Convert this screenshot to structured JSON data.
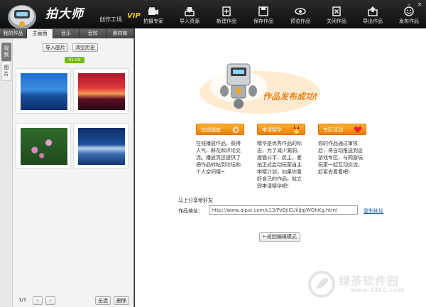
{
  "app": {
    "brand": "拍大师",
    "brand_sub": "创作工场",
    "brand_vip": "VIP"
  },
  "toolbar": [
    {
      "name": "拍摄专家",
      "icon": "camera-icon"
    },
    {
      "name": "导入资源",
      "icon": "import-icon"
    },
    {
      "name": "新建作品",
      "icon": "new-file-icon"
    },
    {
      "name": "保存作品",
      "icon": "save-icon"
    },
    {
      "name": "预览作品",
      "icon": "preview-eye-icon"
    },
    {
      "name": "关闭作品",
      "icon": "close-file-icon"
    },
    {
      "name": "导出作品",
      "icon": "export-icon"
    },
    {
      "name": "发布作品",
      "icon": "publish-smile-icon"
    }
  ],
  "window": {
    "minimize": "–",
    "close": "×"
  },
  "left": {
    "tabs": [
      "我的作品",
      "主画面",
      "音乐",
      "音效",
      "素材库"
    ],
    "vtabs": [
      "视频",
      "图片"
    ],
    "import_label": "导入图片",
    "clear_label": "清空历史",
    "count_badge": "01:09",
    "pager": {
      "page": "1/1",
      "prev": "‹",
      "next": "›"
    },
    "select_all": "全选",
    "delete": "删除"
  },
  "main": {
    "title": "作品发布成功!",
    "tags": [
      {
        "label": "在线播放",
        "desc": [
          "在线播放作品，获得",
          "人气、鲜花和评论交",
          "流。播放页还提供了",
          "把作品转帖到论坛和",
          "个人空间哦~"
        ]
      },
      {
        "label": "申请精华",
        "desc": [
          "精华是优秀作品的标",
          "志，为了减少漏洞，",
          "提倡公平、民主，爱",
          "拍正式启动玩家自主",
          "申精计划，如果你看",
          "好自己的作品，就立",
          "即申请精华吧!"
        ]
      },
      {
        "label": "专区活动",
        "desc": [
          "你的作品通过审核",
          "后，将自动推送到这",
          "游戏专区，与网游玩",
          "玩家一起互动交流，",
          "赶紧去看看吧!"
        ]
      }
    ],
    "share_title": "马上分享给好友",
    "url_label": "作品地址：",
    "url_value": "http://www.aipai.com/c13/PzBjICUiliJqJWQhKg.html",
    "copy_label": "复制地址",
    "back_label": "←返回编辑模式"
  },
  "watermark": {
    "text": "绿茶软件园",
    "url": "www.33LC.com"
  },
  "colors": {
    "accent_orange": "#f08000",
    "badge_green": "#74b816",
    "link_blue": "#1b5ea8"
  }
}
